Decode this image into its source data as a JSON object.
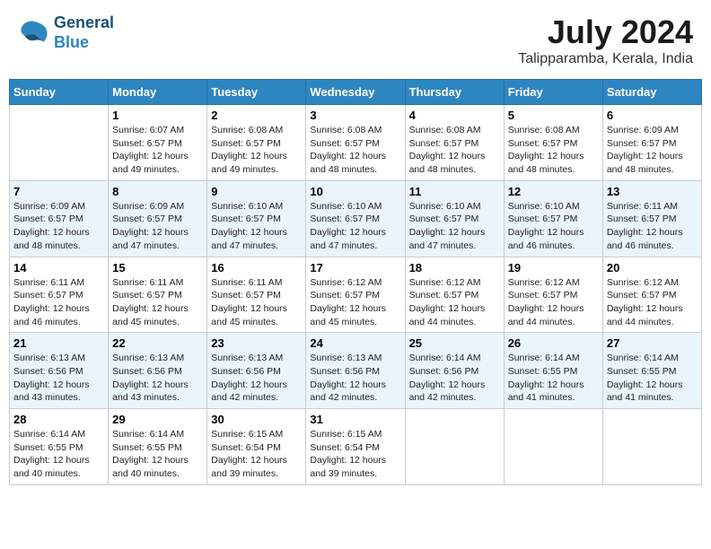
{
  "header": {
    "logo_line1": "General",
    "logo_line2": "Blue",
    "title": "July 2024",
    "subtitle": "Talipparamba, Kerala, India"
  },
  "days_of_week": [
    "Sunday",
    "Monday",
    "Tuesday",
    "Wednesday",
    "Thursday",
    "Friday",
    "Saturday"
  ],
  "weeks": [
    [
      {
        "day": "",
        "detail": ""
      },
      {
        "day": "1",
        "detail": "Sunrise: 6:07 AM\nSunset: 6:57 PM\nDaylight: 12 hours\nand 49 minutes."
      },
      {
        "day": "2",
        "detail": "Sunrise: 6:08 AM\nSunset: 6:57 PM\nDaylight: 12 hours\nand 49 minutes."
      },
      {
        "day": "3",
        "detail": "Sunrise: 6:08 AM\nSunset: 6:57 PM\nDaylight: 12 hours\nand 48 minutes."
      },
      {
        "day": "4",
        "detail": "Sunrise: 6:08 AM\nSunset: 6:57 PM\nDaylight: 12 hours\nand 48 minutes."
      },
      {
        "day": "5",
        "detail": "Sunrise: 6:08 AM\nSunset: 6:57 PM\nDaylight: 12 hours\nand 48 minutes."
      },
      {
        "day": "6",
        "detail": "Sunrise: 6:09 AM\nSunset: 6:57 PM\nDaylight: 12 hours\nand 48 minutes."
      }
    ],
    [
      {
        "day": "7",
        "detail": "Sunrise: 6:09 AM\nSunset: 6:57 PM\nDaylight: 12 hours\nand 48 minutes."
      },
      {
        "day": "8",
        "detail": "Sunrise: 6:09 AM\nSunset: 6:57 PM\nDaylight: 12 hours\nand 47 minutes."
      },
      {
        "day": "9",
        "detail": "Sunrise: 6:10 AM\nSunset: 6:57 PM\nDaylight: 12 hours\nand 47 minutes."
      },
      {
        "day": "10",
        "detail": "Sunrise: 6:10 AM\nSunset: 6:57 PM\nDaylight: 12 hours\nand 47 minutes."
      },
      {
        "day": "11",
        "detail": "Sunrise: 6:10 AM\nSunset: 6:57 PM\nDaylight: 12 hours\nand 47 minutes."
      },
      {
        "day": "12",
        "detail": "Sunrise: 6:10 AM\nSunset: 6:57 PM\nDaylight: 12 hours\nand 46 minutes."
      },
      {
        "day": "13",
        "detail": "Sunrise: 6:11 AM\nSunset: 6:57 PM\nDaylight: 12 hours\nand 46 minutes."
      }
    ],
    [
      {
        "day": "14",
        "detail": "Sunrise: 6:11 AM\nSunset: 6:57 PM\nDaylight: 12 hours\nand 46 minutes."
      },
      {
        "day": "15",
        "detail": "Sunrise: 6:11 AM\nSunset: 6:57 PM\nDaylight: 12 hours\nand 45 minutes."
      },
      {
        "day": "16",
        "detail": "Sunrise: 6:11 AM\nSunset: 6:57 PM\nDaylight: 12 hours\nand 45 minutes."
      },
      {
        "day": "17",
        "detail": "Sunrise: 6:12 AM\nSunset: 6:57 PM\nDaylight: 12 hours\nand 45 minutes."
      },
      {
        "day": "18",
        "detail": "Sunrise: 6:12 AM\nSunset: 6:57 PM\nDaylight: 12 hours\nand 44 minutes."
      },
      {
        "day": "19",
        "detail": "Sunrise: 6:12 AM\nSunset: 6:57 PM\nDaylight: 12 hours\nand 44 minutes."
      },
      {
        "day": "20",
        "detail": "Sunrise: 6:12 AM\nSunset: 6:57 PM\nDaylight: 12 hours\nand 44 minutes."
      }
    ],
    [
      {
        "day": "21",
        "detail": "Sunrise: 6:13 AM\nSunset: 6:56 PM\nDaylight: 12 hours\nand 43 minutes."
      },
      {
        "day": "22",
        "detail": "Sunrise: 6:13 AM\nSunset: 6:56 PM\nDaylight: 12 hours\nand 43 minutes."
      },
      {
        "day": "23",
        "detail": "Sunrise: 6:13 AM\nSunset: 6:56 PM\nDaylight: 12 hours\nand 42 minutes."
      },
      {
        "day": "24",
        "detail": "Sunrise: 6:13 AM\nSunset: 6:56 PM\nDaylight: 12 hours\nand 42 minutes."
      },
      {
        "day": "25",
        "detail": "Sunrise: 6:14 AM\nSunset: 6:56 PM\nDaylight: 12 hours\nand 42 minutes."
      },
      {
        "day": "26",
        "detail": "Sunrise: 6:14 AM\nSunset: 6:55 PM\nDaylight: 12 hours\nand 41 minutes."
      },
      {
        "day": "27",
        "detail": "Sunrise: 6:14 AM\nSunset: 6:55 PM\nDaylight: 12 hours\nand 41 minutes."
      }
    ],
    [
      {
        "day": "28",
        "detail": "Sunrise: 6:14 AM\nSunset: 6:55 PM\nDaylight: 12 hours\nand 40 minutes."
      },
      {
        "day": "29",
        "detail": "Sunrise: 6:14 AM\nSunset: 6:55 PM\nDaylight: 12 hours\nand 40 minutes."
      },
      {
        "day": "30",
        "detail": "Sunrise: 6:15 AM\nSunset: 6:54 PM\nDaylight: 12 hours\nand 39 minutes."
      },
      {
        "day": "31",
        "detail": "Sunrise: 6:15 AM\nSunset: 6:54 PM\nDaylight: 12 hours\nand 39 minutes."
      },
      {
        "day": "",
        "detail": ""
      },
      {
        "day": "",
        "detail": ""
      },
      {
        "day": "",
        "detail": ""
      }
    ]
  ]
}
